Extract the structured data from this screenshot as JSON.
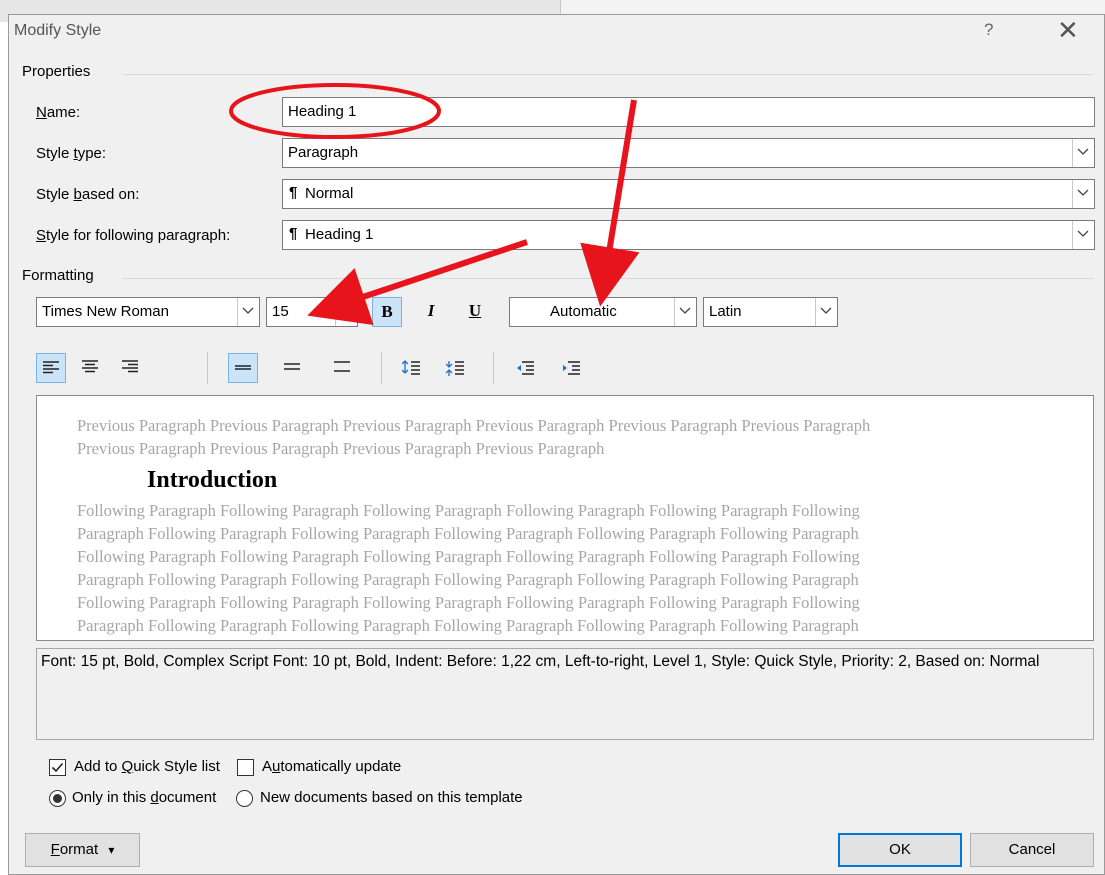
{
  "background_doc": {
    "header_text": ""
  },
  "dialog": {
    "title": "Modify Style",
    "help": "?",
    "close": "✕"
  },
  "properties": {
    "group_label": "Properties",
    "name_label_a": "N",
    "name_label_b": "ame:",
    "name_value": "Heading 1",
    "type_label_a": "Style ",
    "type_label_b": "t",
    "type_label_c": "ype:",
    "type_value": "Paragraph",
    "based_label_a": "Style ",
    "based_label_b": "b",
    "based_label_c": "ased on:",
    "based_value": "Normal",
    "following_label_a": "S",
    "following_label_b": "tyle for following paragraph:",
    "following_value": "Heading 1",
    "pilcrow": "¶"
  },
  "formatting": {
    "group_label": "Formatting",
    "font": "Times New Roman",
    "size": "15",
    "bold": "B",
    "italic": "I",
    "underline": "U",
    "color": "Automatic",
    "script": "Latin"
  },
  "preview": {
    "previous_lines": [
      "Previous Paragraph Previous Paragraph Previous Paragraph Previous Paragraph Previous Paragraph Previous Paragraph",
      "Previous Paragraph Previous Paragraph Previous Paragraph Previous Paragraph"
    ],
    "heading": "Introduction",
    "following_lines": [
      "Following Paragraph Following Paragraph Following Paragraph Following Paragraph Following Paragraph Following",
      "Paragraph Following Paragraph Following Paragraph Following Paragraph Following Paragraph Following Paragraph",
      "Following Paragraph Following Paragraph Following Paragraph Following Paragraph Following Paragraph Following",
      "Paragraph Following Paragraph Following Paragraph Following Paragraph Following Paragraph Following Paragraph",
      "Following Paragraph Following Paragraph Following Paragraph Following Paragraph Following Paragraph Following",
      "Paragraph Following Paragraph Following Paragraph Following Paragraph Following Paragraph Following Paragraph"
    ]
  },
  "description": "Font: 15 pt, Bold, Complex Script Font: 10 pt, Bold, Indent: Before:  1,22 cm, Left-to-right, Level 1, Style: Quick Style, Priority: 2, Based on: Normal",
  "options": {
    "quick_style_a": "Add to ",
    "quick_style_b": "Q",
    "quick_style_c": "uick Style list",
    "quick_style_checked": true,
    "auto_update_a": "A",
    "auto_update_b": "u",
    "auto_update_c": "tomatically update",
    "auto_update_checked": false,
    "only_doc_a": "Only in this ",
    "only_doc_b": "d",
    "only_doc_c": "ocument",
    "new_docs_a": "New documents based on this template",
    "selected": "only_doc"
  },
  "buttons": {
    "format_a": "F",
    "format_b": "ormat",
    "format_arrow": "▾",
    "ok": "OK",
    "cancel": "Cancel"
  },
  "colors": {
    "annotation": "#e8141b",
    "accent": "#0078d7",
    "selection": "#cce4f7"
  }
}
